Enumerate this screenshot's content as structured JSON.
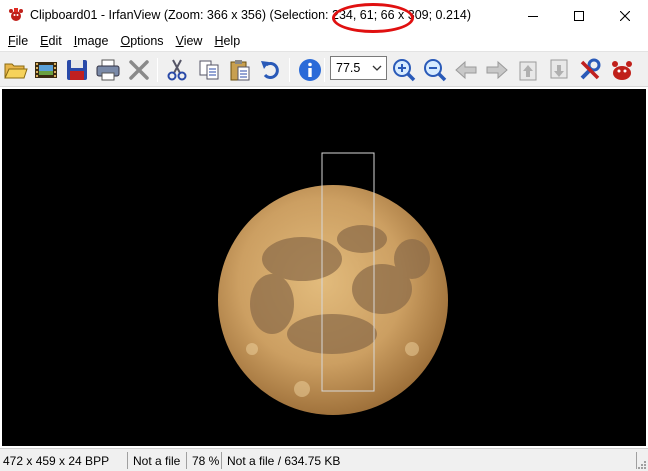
{
  "window": {
    "title": "Clipboard01 - IrfanView (Zoom: 366 x 356) (Selection: 234, 61; 66 x 309; 0.214)",
    "minimize_label": "Minimize",
    "maximize_label": "Maximize",
    "close_label": "Close"
  },
  "menu": [
    {
      "label": "File",
      "accel": "F",
      "rest": "ile"
    },
    {
      "label": "Edit",
      "accel": "E",
      "rest": "dit"
    },
    {
      "label": "Image",
      "accel": "I",
      "rest": "mage"
    },
    {
      "label": "Options",
      "accel": "O",
      "rest": "ptions"
    },
    {
      "label": "View",
      "accel": "V",
      "rest": "iew"
    },
    {
      "label": "Help",
      "accel": "H",
      "rest": "elp"
    }
  ],
  "toolbar": {
    "zoom_value": "77.5",
    "icons": [
      "open-folder-icon",
      "slideshow-icon",
      "save-icon",
      "print-icon",
      "delete-icon",
      "cut-icon",
      "copy-icon",
      "paste-icon",
      "undo-icon",
      "info-icon",
      "zoom-in-icon",
      "zoom-out-icon",
      "previous-icon",
      "next-icon",
      "first-page-icon",
      "last-page-icon",
      "settings-icon",
      "irfanview-logo-icon"
    ]
  },
  "image": {
    "background": "#000000",
    "moon_color": "#c89a5a",
    "selection_color": "#d8d8d8"
  },
  "status": {
    "dimensions": "472 x 459 x 24 BPP",
    "file": "Not a file",
    "zoom": "78 %",
    "size": "Not a file / 634.75 KB"
  },
  "annotation_color": "#e01010"
}
